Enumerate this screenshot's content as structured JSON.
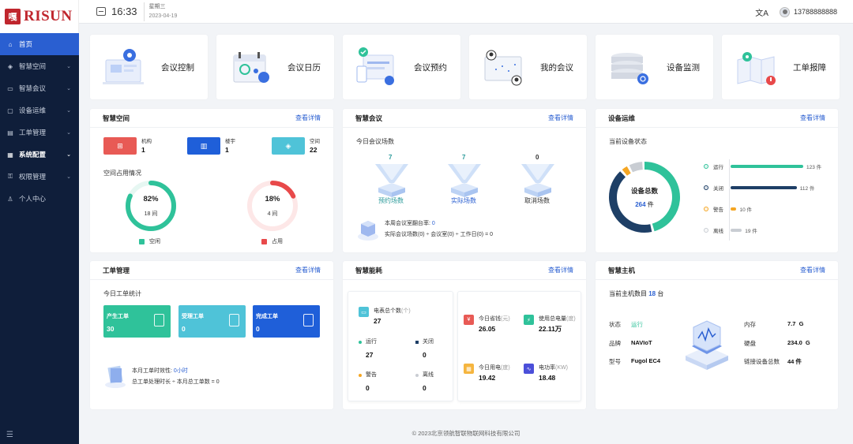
{
  "app": {
    "logo_mark": "嘎",
    "logo_text": "RISUN"
  },
  "sidebar": {
    "items": [
      {
        "label": "首页",
        "icon": "home-icon"
      },
      {
        "label": "智慧空间",
        "icon": "cube-icon"
      },
      {
        "label": "智慧会议",
        "icon": "video-icon"
      },
      {
        "label": "设备运维",
        "icon": "monitor-icon"
      },
      {
        "label": "工单管理",
        "icon": "document-icon"
      },
      {
        "label": "系统配置",
        "icon": "grid-icon"
      },
      {
        "label": "权限管理",
        "icon": "lock-icon"
      },
      {
        "label": "个人中心",
        "icon": "user-icon"
      }
    ],
    "collapse_icon": "menu-fold-icon"
  },
  "topbar": {
    "time": "16:33",
    "weekday": "星期三",
    "date": "2023-04-19",
    "translate_icon": "translate-icon",
    "phone": "13788888888"
  },
  "quick_links": [
    {
      "label": "会议控制",
      "icon": "meeting-control-illustration"
    },
    {
      "label": "会议日历",
      "icon": "calendar-illustration"
    },
    {
      "label": "会议预约",
      "icon": "reservation-illustration"
    },
    {
      "label": "我的会议",
      "icon": "my-meeting-illustration"
    },
    {
      "label": "设备监测",
      "icon": "server-monitor-illustration"
    },
    {
      "label": "工单报障",
      "icon": "map-fault-illustration"
    }
  ],
  "space": {
    "title": "智慧空间",
    "link": "查看详情",
    "stats": [
      {
        "label": "机构",
        "value": "1",
        "color": "#e85a55"
      },
      {
        "label": "楼宇",
        "value": "1",
        "color": "#1f5fd9"
      },
      {
        "label": "空间",
        "value": "22",
        "color": "#4fc3d8"
      }
    ],
    "occupancy_title": "空间占用情况",
    "rings": [
      {
        "pct": "82%",
        "sub": "18 间",
        "fraction": 0.82,
        "color": "#2fc29a",
        "bg": "#e6f7f2",
        "legend": "空闲"
      },
      {
        "pct": "18%",
        "sub": "4 间",
        "fraction": 0.18,
        "color": "#e8494a",
        "bg": "#fde7e7",
        "legend": "占用"
      }
    ]
  },
  "meeting": {
    "title": "智慧会议",
    "link": "查看详情",
    "today_title": "今日会议场数",
    "funnels": [
      {
        "value": "7",
        "label": "预约场数",
        "color": "#2a9a9a"
      },
      {
        "value": "7",
        "label": "实际场数",
        "color": "#2a5fd1"
      },
      {
        "value": "0",
        "label": "取消场数",
        "color": "#333"
      }
    ],
    "rate_label": "本周会议室翻台率:",
    "rate_value": "0",
    "formula": "实际会议场数(0) ÷ 会议室(0) ÷ 工作日(0) = 0"
  },
  "device": {
    "title": "设备运维",
    "link": "查看详情",
    "status_title": "当前设备状态",
    "total_label": "设备总数",
    "total_value": "264",
    "total_unit": "件",
    "bars": [
      {
        "label": "运行",
        "value": 123,
        "text": "123 件",
        "color": "#2fc29a"
      },
      {
        "label": "关闭",
        "value": 112,
        "text": "112 件",
        "color": "#1e3f66"
      },
      {
        "label": "警告",
        "value": 10,
        "text": "10 件",
        "color": "#f5a623"
      },
      {
        "label": "离线",
        "value": 19,
        "text": "19 件",
        "color": "#c9cdd3"
      }
    ]
  },
  "workorder": {
    "title": "工单管理",
    "link": "查看详情",
    "today_title": "今日工单统计",
    "boxes": [
      {
        "label": "产生工单",
        "value": "30",
        "color": "#2fc29a"
      },
      {
        "label": "受理工单",
        "value": "0",
        "color": "#4fc3d8"
      },
      {
        "label": "完成工单",
        "value": "0",
        "color": "#1f5fd9"
      }
    ],
    "eff_label": "本月工单时效性:",
    "eff_value": "0小时",
    "formula": "总工单处理时长 ÷ 本月总工单数 = 0"
  },
  "energy": {
    "title": "智慧能耗",
    "link": "查看详情",
    "meter_label": "电表总个数",
    "meter_unit": "(个)",
    "meter_value": "27",
    "states": [
      {
        "label": "运行",
        "value": "27",
        "color": "#2fc29a"
      },
      {
        "label": "关闭",
        "value": "0",
        "color": "#1e3f66"
      },
      {
        "label": "警告",
        "value": "0",
        "color": "#f5a623"
      },
      {
        "label": "离线",
        "value": "0",
        "color": "#c9cdd3"
      }
    ],
    "metrics": [
      {
        "label": "今日省钱",
        "unit": "(元)",
        "value": "26.05",
        "color": "#e85a55"
      },
      {
        "label": "使用总电量",
        "unit": "(度)",
        "value": "22.11万",
        "color": "#2fc29a"
      },
      {
        "label": "今日用电",
        "unit": "(度)",
        "value": "19.42",
        "color": "#f5b53f"
      },
      {
        "label": "电功率",
        "unit": "(KW)",
        "value": "18.48",
        "color": "#4b4fd9"
      }
    ]
  },
  "host": {
    "title": "智慧主机",
    "link": "查看详情",
    "count_label": "当前主机数目",
    "count_value": "18",
    "count_unit": "台",
    "left": [
      {
        "k": "状态",
        "v": "运行"
      },
      {
        "k": "品牌",
        "v": "NAVIoT"
      },
      {
        "k": "型号",
        "v": "Fugol EC4"
      }
    ],
    "right": [
      {
        "k": "内存",
        "v": "7.7  G"
      },
      {
        "k": "硬盘",
        "v": "234.0  G"
      },
      {
        "k": "链接设备总数",
        "v": "44 件"
      }
    ]
  },
  "footer": "© 2023北京领航智联物联网科技有限公司"
}
